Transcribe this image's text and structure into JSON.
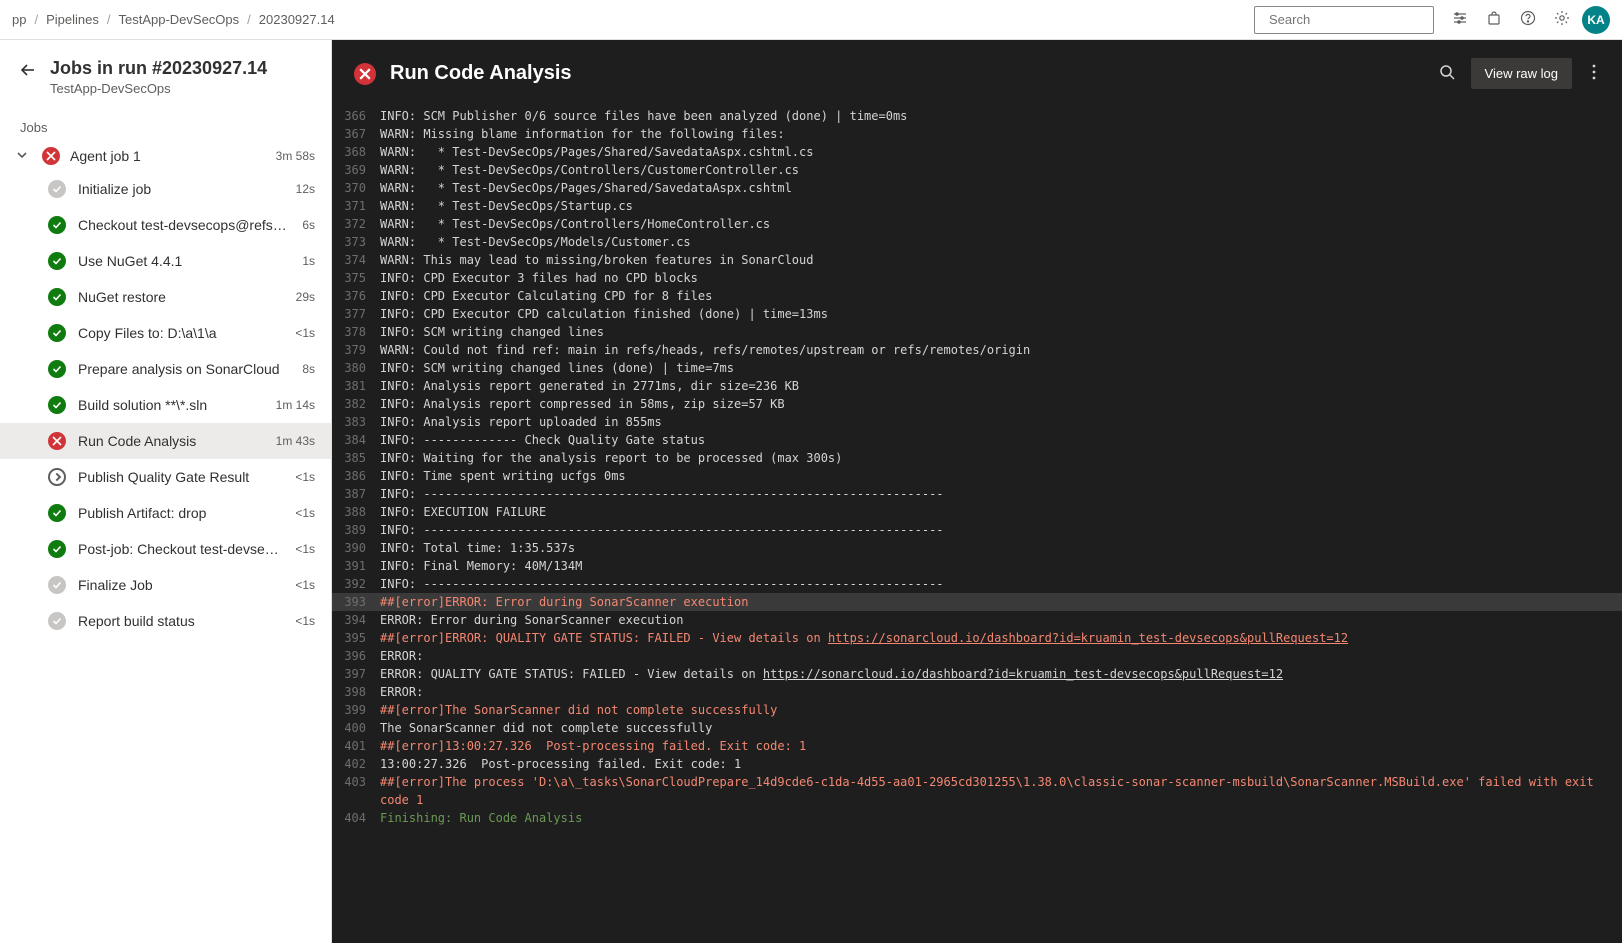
{
  "breadcrumb": [
    "pp",
    "Pipelines",
    "TestApp-DevSecOps",
    "20230927.14"
  ],
  "search_placeholder": "Search",
  "avatar_initials": "KA",
  "sidebar": {
    "title": "Jobs in run #20230927.14",
    "subtitle": "TestApp-DevSecOps",
    "section": "Jobs",
    "job": {
      "name": "Agent job 1",
      "duration": "3m 58s",
      "status": "error"
    },
    "selected_step_index": 7,
    "steps": [
      {
        "status": "neutral",
        "label": "Initialize job",
        "duration": "12s"
      },
      {
        "status": "success",
        "label": "Checkout test-devsecops@refs/p...",
        "duration": "6s"
      },
      {
        "status": "success",
        "label": "Use NuGet 4.4.1",
        "duration": "1s"
      },
      {
        "status": "success",
        "label": "NuGet restore",
        "duration": "29s"
      },
      {
        "status": "success",
        "label": "Copy Files to: D:\\a\\1\\a",
        "duration": "<1s"
      },
      {
        "status": "success",
        "label": "Prepare analysis on SonarCloud",
        "duration": "8s"
      },
      {
        "status": "success",
        "label": "Build solution **\\*.sln",
        "duration": "1m 14s"
      },
      {
        "status": "error",
        "label": "Run Code Analysis",
        "duration": "1m 43s"
      },
      {
        "status": "pending",
        "label": "Publish Quality Gate Result",
        "duration": "<1s"
      },
      {
        "status": "success",
        "label": "Publish Artifact: drop",
        "duration": "<1s"
      },
      {
        "status": "success",
        "label": "Post-job: Checkout test-devseco...",
        "duration": "<1s"
      },
      {
        "status": "neutral",
        "label": "Finalize Job",
        "duration": "<1s"
      },
      {
        "status": "neutral",
        "label": "Report build status",
        "duration": "<1s"
      }
    ]
  },
  "logpane": {
    "title": "Run Code Analysis",
    "raw_button": "View raw log",
    "lines": [
      {
        "n": 366,
        "cls": "",
        "t": "INFO: SCM Publisher 0/6 source files have been analyzed (done) | time=0ms"
      },
      {
        "n": 367,
        "cls": "",
        "t": "WARN: Missing blame information for the following files:"
      },
      {
        "n": 368,
        "cls": "",
        "t": "WARN:   * Test-DevSecOps/Pages/Shared/SavedataAspx.cshtml.cs"
      },
      {
        "n": 369,
        "cls": "",
        "t": "WARN:   * Test-DevSecOps/Controllers/CustomerController.cs"
      },
      {
        "n": 370,
        "cls": "",
        "t": "WARN:   * Test-DevSecOps/Pages/Shared/SavedataAspx.cshtml"
      },
      {
        "n": 371,
        "cls": "",
        "t": "WARN:   * Test-DevSecOps/Startup.cs"
      },
      {
        "n": 372,
        "cls": "",
        "t": "WARN:   * Test-DevSecOps/Controllers/HomeController.cs"
      },
      {
        "n": 373,
        "cls": "",
        "t": "WARN:   * Test-DevSecOps/Models/Customer.cs"
      },
      {
        "n": 374,
        "cls": "",
        "t": "WARN: This may lead to missing/broken features in SonarCloud"
      },
      {
        "n": 375,
        "cls": "",
        "t": "INFO: CPD Executor 3 files had no CPD blocks"
      },
      {
        "n": 376,
        "cls": "",
        "t": "INFO: CPD Executor Calculating CPD for 8 files"
      },
      {
        "n": 377,
        "cls": "",
        "t": "INFO: CPD Executor CPD calculation finished (done) | time=13ms"
      },
      {
        "n": 378,
        "cls": "",
        "t": "INFO: SCM writing changed lines"
      },
      {
        "n": 379,
        "cls": "",
        "t": "WARN: Could not find ref: main in refs/heads, refs/remotes/upstream or refs/remotes/origin"
      },
      {
        "n": 380,
        "cls": "",
        "t": "INFO: SCM writing changed lines (done) | time=7ms"
      },
      {
        "n": 381,
        "cls": "",
        "t": "INFO: Analysis report generated in 2771ms, dir size=236 KB"
      },
      {
        "n": 382,
        "cls": "",
        "t": "INFO: Analysis report compressed in 58ms, zip size=57 KB"
      },
      {
        "n": 383,
        "cls": "",
        "t": "INFO: Analysis report uploaded in 855ms"
      },
      {
        "n": 384,
        "cls": "",
        "t": "INFO: ------------- Check Quality Gate status"
      },
      {
        "n": 385,
        "cls": "",
        "t": "INFO: Waiting for the analysis report to be processed (max 300s)"
      },
      {
        "n": 386,
        "cls": "",
        "t": "INFO: Time spent writing ucfgs 0ms"
      },
      {
        "n": 387,
        "cls": "",
        "t": "INFO: ------------------------------------------------------------------------"
      },
      {
        "n": 388,
        "cls": "",
        "t": "INFO: EXECUTION FAILURE"
      },
      {
        "n": 389,
        "cls": "",
        "t": "INFO: ------------------------------------------------------------------------"
      },
      {
        "n": 390,
        "cls": "",
        "t": "INFO: Total time: 1:35.537s"
      },
      {
        "n": 391,
        "cls": "",
        "t": "INFO: Final Memory: 40M/134M"
      },
      {
        "n": 392,
        "cls": "",
        "t": "INFO: ------------------------------------------------------------------------"
      },
      {
        "n": 393,
        "cls": "err hl",
        "t": "##[error]ERROR: Error during SonarScanner execution"
      },
      {
        "n": 394,
        "cls": "",
        "t": "ERROR: Error during SonarScanner execution"
      },
      {
        "n": 395,
        "cls": "err",
        "t": "##[error]ERROR: QUALITY GATE STATUS: FAILED - View details on ",
        "link": "https://sonarcloud.io/dashboard?id=kruamin_test-devsecops&pullRequest=12"
      },
      {
        "n": 396,
        "cls": "",
        "t": "ERROR:"
      },
      {
        "n": 397,
        "cls": "",
        "t": "ERROR: QUALITY GATE STATUS: FAILED - View details on ",
        "link": "https://sonarcloud.io/dashboard?id=kruamin_test-devsecops&pullRequest=12"
      },
      {
        "n": 398,
        "cls": "",
        "t": "ERROR:"
      },
      {
        "n": 399,
        "cls": "err",
        "t": "##[error]The SonarScanner did not complete successfully"
      },
      {
        "n": 400,
        "cls": "",
        "t": "The SonarScanner did not complete successfully"
      },
      {
        "n": 401,
        "cls": "err",
        "t": "##[error]13:00:27.326  Post-processing failed. Exit code: 1"
      },
      {
        "n": 402,
        "cls": "",
        "t": "13:00:27.326  Post-processing failed. Exit code: 1"
      },
      {
        "n": 403,
        "cls": "err",
        "t": "##[error]The process 'D:\\a\\_tasks\\SonarCloudPrepare_14d9cde6-c1da-4d55-aa01-2965cd301255\\1.38.0\\classic-sonar-scanner-msbuild\\SonarScanner.MSBuild.exe' failed with exit code 1"
      },
      {
        "n": 404,
        "cls": "ok",
        "t": "Finishing: Run Code Analysis"
      }
    ]
  }
}
